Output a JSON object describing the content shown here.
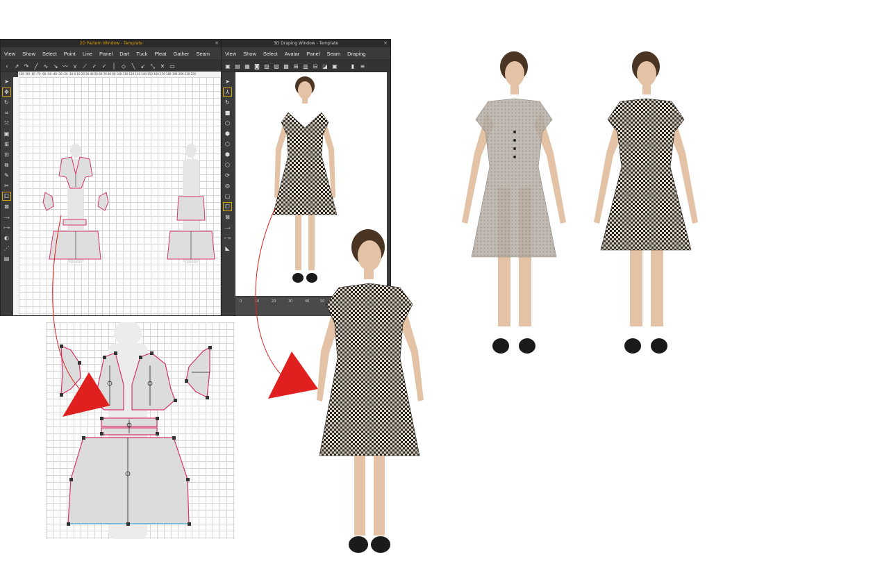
{
  "pattern_window": {
    "title": "2D Pattern Window - Template",
    "menu": [
      "View",
      "Show",
      "Select",
      "Point",
      "Line",
      "Panel",
      "Dart",
      "Tuck",
      "Pleat",
      "Gather",
      "Seam"
    ],
    "ruler_labels": "-100 -90 -80 -70 -60 -50 -40 -30 -20 -10 0 10 20 30 40 50 60 70 80 90 100 110 120 130 140 150 160 170 180 190 200 210 220"
  },
  "draping_window": {
    "title": "3D Draping Window - Template",
    "menu": [
      "View",
      "Show",
      "Select",
      "Avatar",
      "Panel",
      "Seam",
      "Draping"
    ],
    "timeline_ticks": [
      "0",
      "10",
      "20",
      "30",
      "40",
      "50"
    ]
  },
  "icons": {
    "close": "×",
    "arrow": "red-curved-arrow",
    "select_tool": "cursor-icon",
    "move_tool": "move-icon",
    "rotate_tool": "rotate-icon"
  },
  "colors": {
    "seam": "#d6336c",
    "arrow": "#e0201f",
    "fabric_dark": "#2e2a26",
    "fabric_light": "#d9d2c4",
    "skin": "#e3c2a6",
    "title_accent": "#e0a000"
  }
}
